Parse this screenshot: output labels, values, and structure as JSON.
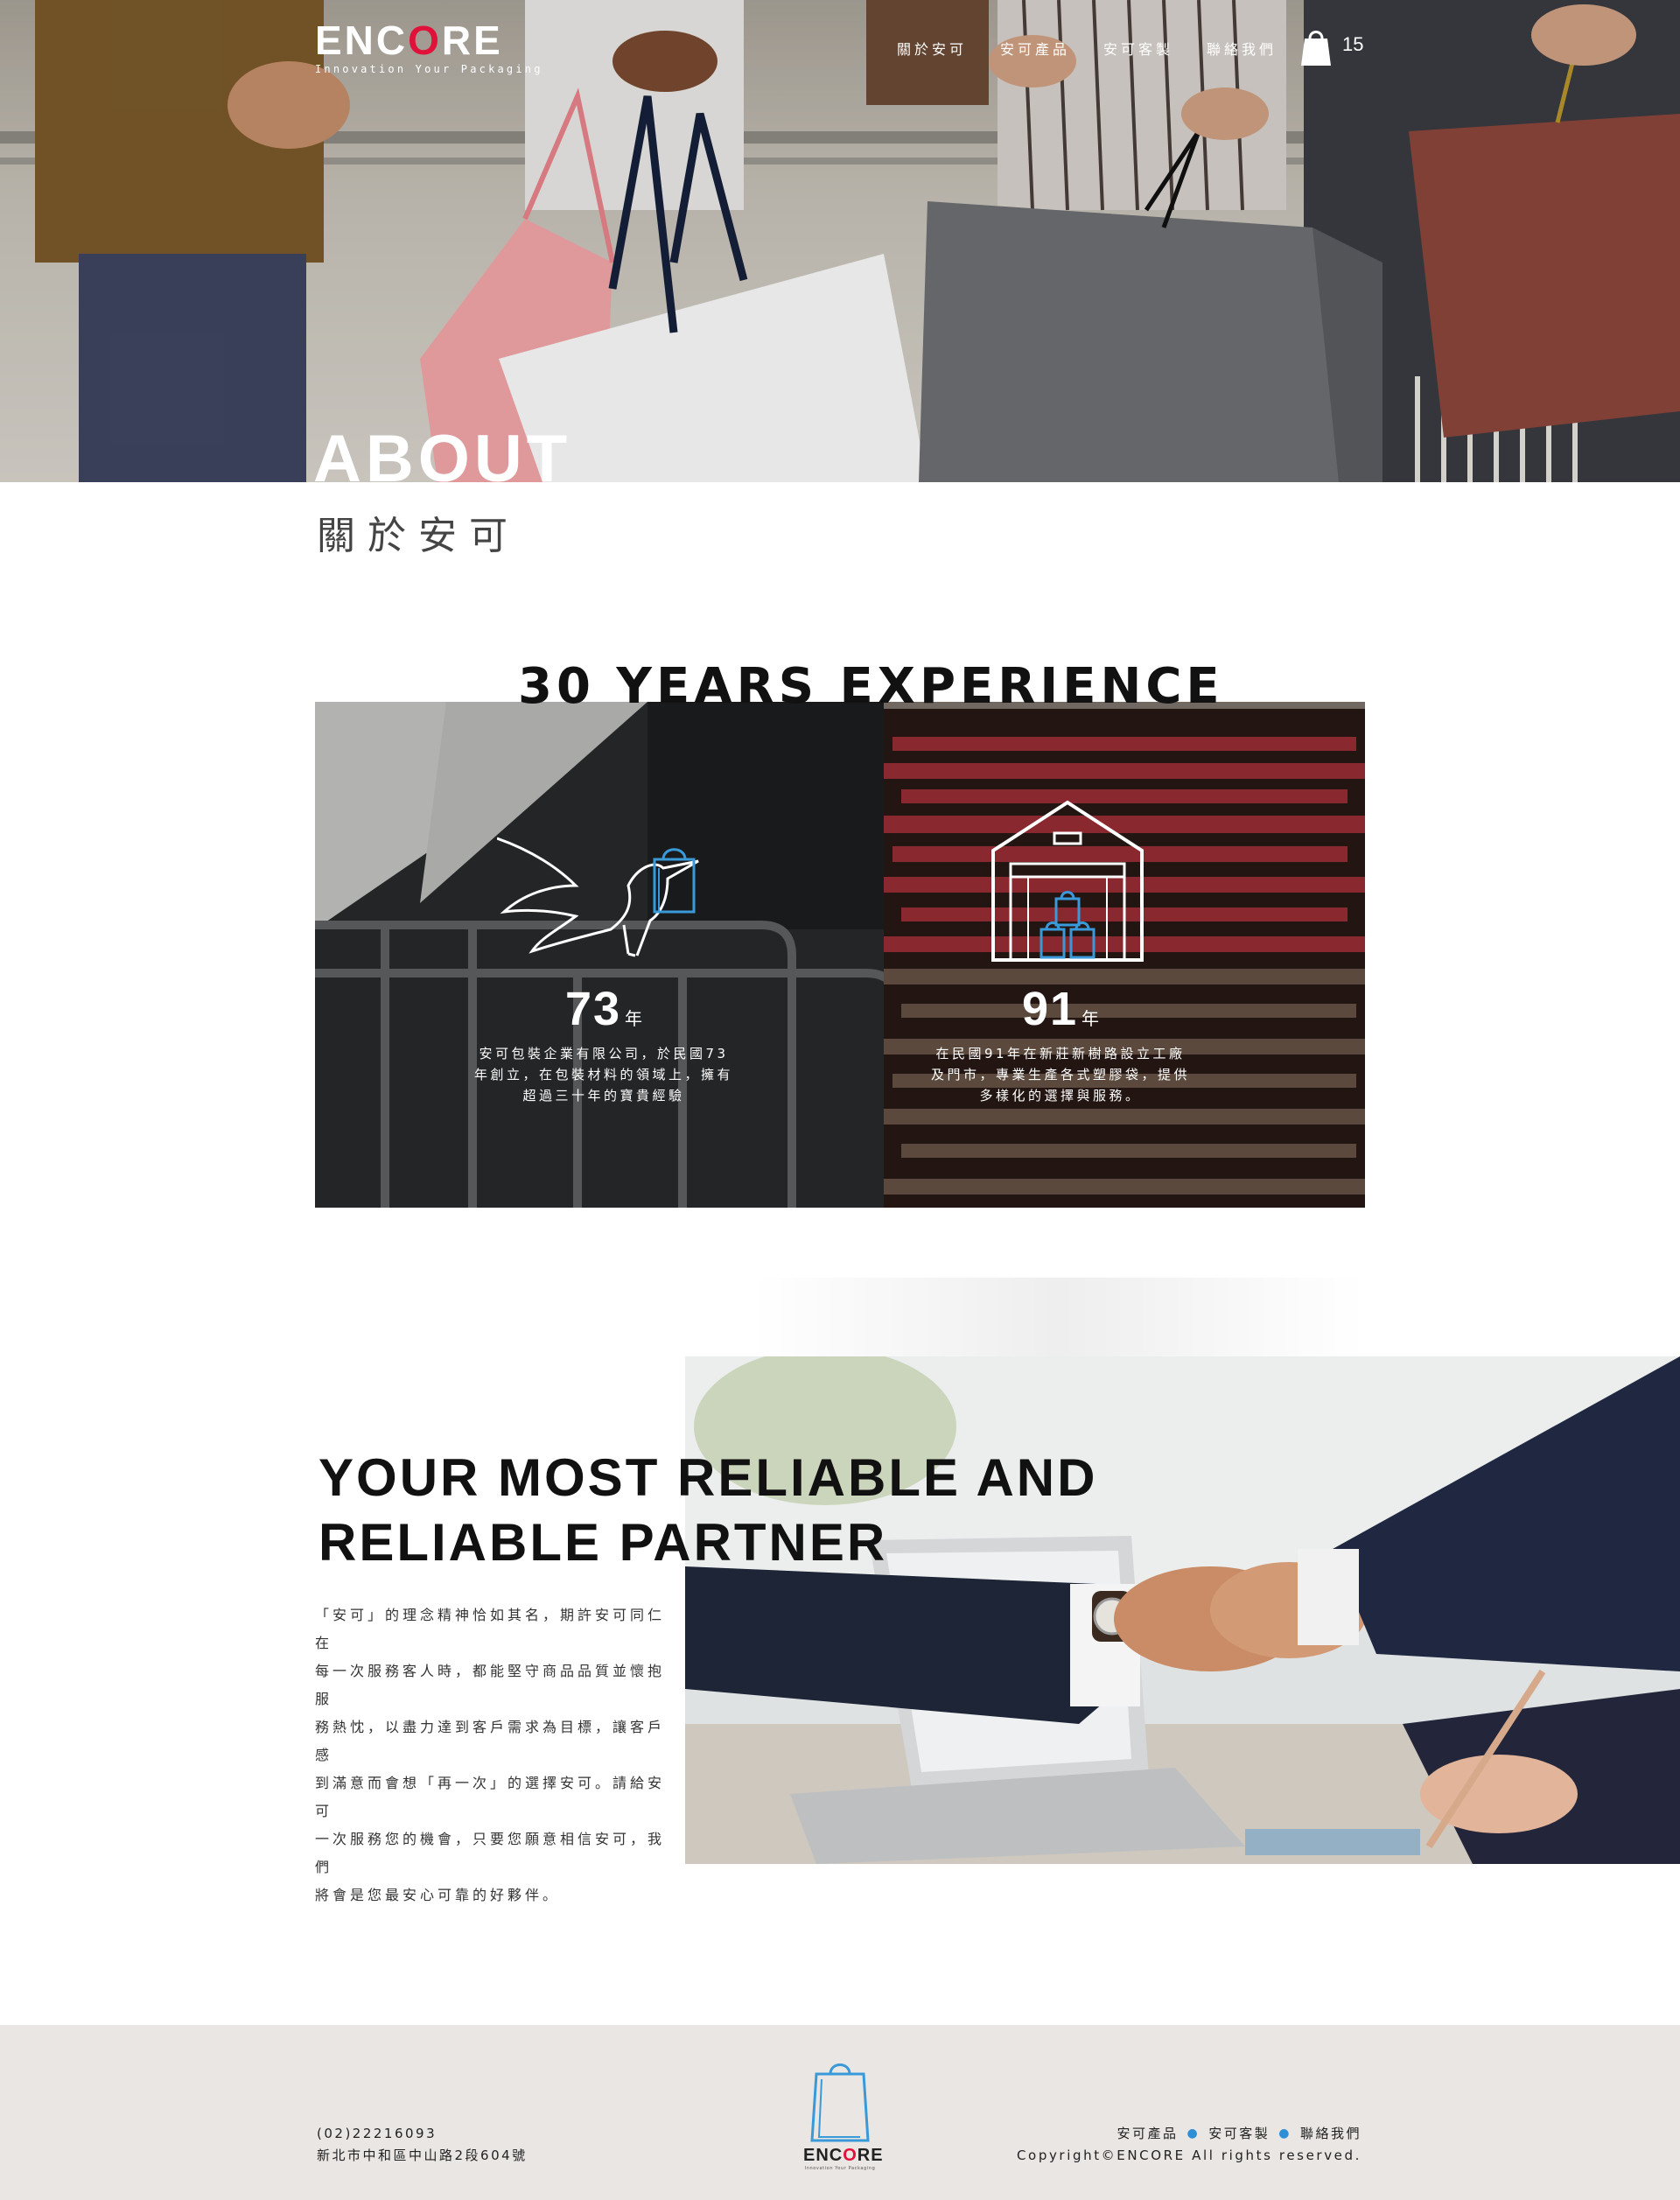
{
  "brand": {
    "name_prefix": "ENC",
    "name_o": "O",
    "name_suffix": "RE",
    "tagline": "Innovation Your Packaging"
  },
  "nav": {
    "items": [
      "關於安可",
      "安可產品",
      "安可客製",
      "聯絡我們"
    ],
    "cart_count": "15"
  },
  "hero": {
    "title": "ABOUT",
    "subtitle": "關於安可"
  },
  "experience": {
    "title": "30 YEARS EXPERIENCE",
    "stats": [
      {
        "number": "73",
        "unit": "年",
        "lines": [
          "安可包裝企業有限公司，於民國73",
          "年創立，在包裝材料的領域上，擁有",
          "超過三十年的寶貴經驗"
        ]
      },
      {
        "number": "91",
        "unit": "年",
        "lines": [
          "在民國91年在新莊新樹路設立工廠",
          "及門市，專業生產各式塑膠袋，提供",
          "多樣化的選擇與服務。"
        ]
      }
    ]
  },
  "partner": {
    "title_line1": "YOUR MOST RELIABLE AND",
    "title_line2": "RELIABLE PARTNER",
    "paragraph": [
      "「安可」的理念精神恰如其名，期許安可同仁在",
      "每一次服務客人時，都能堅守商品品質並懷抱服",
      "務熱忱，以盡力達到客戶需求為目標，讓客戶感",
      "到滿意而會想「再一次」的選擇安可。請給安可",
      "一次服務您的機會，只要您願意相信安可，我們",
      "將會是您最安心可靠的好夥伴。"
    ]
  },
  "footer": {
    "phone": "(02)22216093",
    "address": "新北市中和區中山路2段604號",
    "logo_tagline": "Innovation Your Packaging",
    "links": [
      "安可產品",
      "安可客製",
      "聯絡我們"
    ],
    "copyright": "Copyright©ENCORE All rights reserved."
  },
  "colors": {
    "accent_red": "#e0123a",
    "accent_blue": "#2d8fd6",
    "footer_bg": "#e9e6e3"
  },
  "icons": [
    "shopping-bag-icon",
    "bird-carrying-bag-icon",
    "warehouse-icon",
    "footer-bag-logo-icon"
  ]
}
